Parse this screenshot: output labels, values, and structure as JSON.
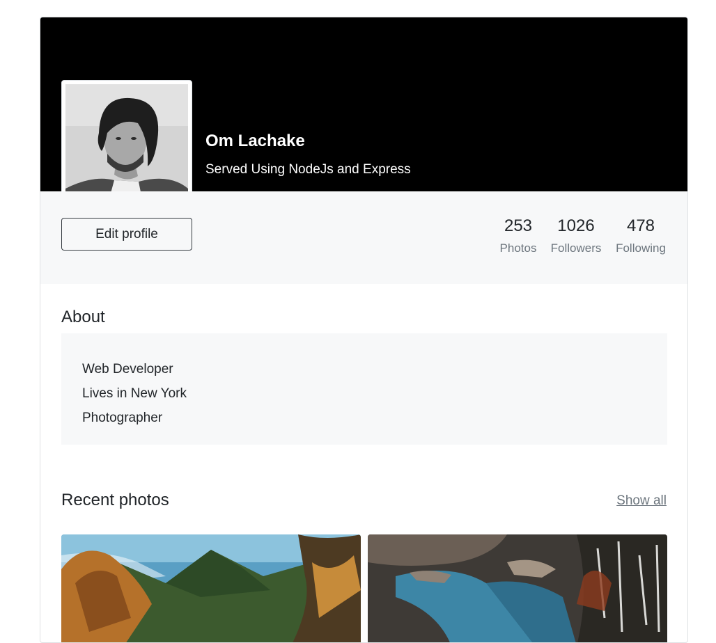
{
  "profile": {
    "name": "Om Lachake",
    "tagline": "Served Using NodeJs and Express",
    "edit_label": "Edit profile"
  },
  "stats": [
    {
      "value": "253",
      "label": "Photos"
    },
    {
      "value": "1026",
      "label": "Followers"
    },
    {
      "value": "478",
      "label": "Following"
    }
  ],
  "about": {
    "title": "About",
    "lines": [
      "Web Developer",
      "Lives in New York",
      "Photographer"
    ]
  },
  "recent": {
    "title": "Recent photos",
    "show_all": "Show all",
    "photos": [
      "mountain-photo",
      "river-photo"
    ]
  },
  "colors": {
    "cover": "#000000",
    "panel": "#f7f8f9",
    "muted": "#6c757d"
  }
}
